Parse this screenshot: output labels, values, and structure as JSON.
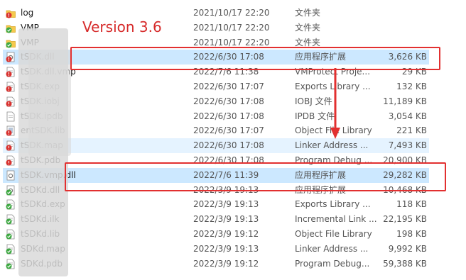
{
  "annotation": {
    "version_label": "Version 3.6"
  },
  "files": [
    {
      "name": "log",
      "date": "2021/10/17 22:20",
      "type": "文件夹",
      "size": "",
      "icon": "folder-error-icon"
    },
    {
      "name": "VMP",
      "date": "2021/10/17 22:20",
      "type": "文件夹",
      "size": "",
      "icon": "folder-check-icon"
    },
    {
      "name": "VMP",
      "date": "2021/10/17 22:20",
      "type": "文件夹",
      "size": "",
      "icon": "folder-check-icon"
    },
    {
      "name": "tSDK.dll",
      "date": "2022/6/30 17:08",
      "type": "应用程序扩展",
      "size": "3,626 KB",
      "icon": "dll-error-icon"
    },
    {
      "name": "tSDK.dll.vmp",
      "date": "2022/7/6 11:38",
      "type": "VMProtect Proje...",
      "size": "29 KB",
      "icon": "file-error-icon"
    },
    {
      "name": "tSDK.exp",
      "date": "2022/6/30 17:07",
      "type": "Exports Library ...",
      "size": "132 KB",
      "icon": "file-error-icon"
    },
    {
      "name": "tSDK.iobj",
      "date": "2022/6/30 17:08",
      "type": "IOBJ 文件",
      "size": "11,189 KB",
      "icon": "file-error-icon"
    },
    {
      "name": "tSDK.ipdb",
      "date": "2022/6/30 17:08",
      "type": "IPDB 文件",
      "size": "3,054 KB",
      "icon": "file-icon"
    },
    {
      "name": "entSDK.lib",
      "date": "2022/6/30 17:07",
      "type": "Object File Library",
      "size": "221 KB",
      "icon": "lib-error-icon"
    },
    {
      "name": "tSDK.map",
      "date": "2022/6/30 17:08",
      "type": "Linker Address ...",
      "size": "7,493 KB",
      "icon": "file-error-icon"
    },
    {
      "name": "tSDK.pdb",
      "date": "2022/6/30 17:08",
      "type": "Program Debug ...",
      "size": "20,900 KB",
      "icon": "file-error-icon"
    },
    {
      "name": "tSDK.vmp.dll",
      "date": "2022/7/6 11:39",
      "type": "应用程序扩展",
      "size": "29,282 KB",
      "icon": "dll-icon"
    },
    {
      "name": "tSDKd.dll",
      "date": "2022/3/9 19:13",
      "type": "应用程序扩展",
      "size": "10,468 KB",
      "icon": "dll-check-icon"
    },
    {
      "name": "tSDKd.exp",
      "date": "2022/3/9 19:13",
      "type": "Exports Library ...",
      "size": "118 KB",
      "icon": "file-check-icon"
    },
    {
      "name": "tSDKd.ilk",
      "date": "2022/3/9 19:13",
      "type": "Incremental Link ...",
      "size": "22,195 KB",
      "icon": "file-check-icon"
    },
    {
      "name": "tSDKd.lib",
      "date": "2022/3/9 19:12",
      "type": "Object File Library",
      "size": "198 KB",
      "icon": "file-check-icon"
    },
    {
      "name": "SDKd.map",
      "date": "2022/3/9 19:13",
      "type": "Linker Address ...",
      "size": "9,992 KB",
      "icon": "file-check-icon"
    },
    {
      "name": "SDKd.pdb",
      "date": "2022/3/9 19:12",
      "type": "Program Debug...",
      "size": "59,388 KB",
      "icon": "file-check-icon"
    }
  ],
  "colors": {
    "annotation_red": "#e23030",
    "selection": "#cce8ff",
    "hover": "#e5f3ff"
  }
}
